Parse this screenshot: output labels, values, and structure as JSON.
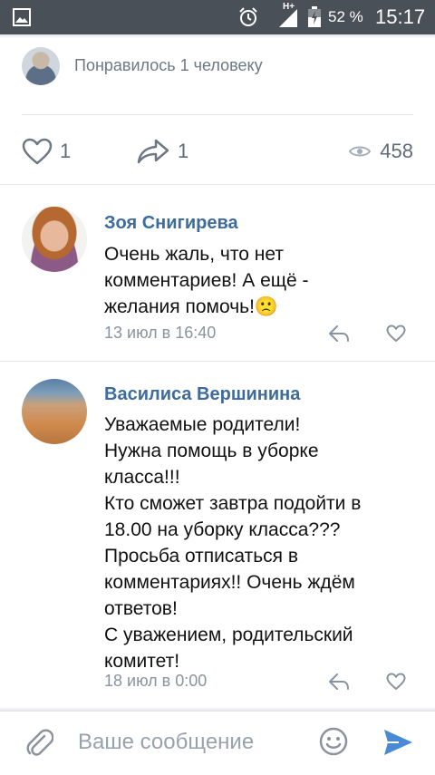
{
  "status_bar": {
    "network": "H+",
    "battery_percent": "52 %",
    "time": "15:17"
  },
  "post": {
    "liked_by": "Понравилось 1 человеку",
    "likes": "1",
    "shares": "1",
    "views": "458"
  },
  "comments": [
    {
      "author": "Зоя Снигирева",
      "text": "Очень жаль, что нет\nкомментариев! А ещё -\nжелания помочь!",
      "emoji": "🙁",
      "date": "13 июл в 16:40"
    },
    {
      "author": "Василиса Вершинина",
      "text": "Уважаемые родители!\nНужна помощь в уборке\nкласса!!!\nКто сможет завтра подойти в\n18.00 на уборку класса???\n Просьба отписаться в\nкомментариях!! Очень ждём\nответов!\nС уважением, родительский\nкомитет!",
      "date": "18 июл в 0:00"
    }
  ],
  "composer": {
    "placeholder": "Ваше сообщение"
  },
  "colors": {
    "status_bar": "#4a5057",
    "author_name": "#3d6b9c",
    "muted": "#8a939e",
    "send": "#4a8ad4"
  },
  "icons": [
    "gallery-icon",
    "alarm-icon",
    "signal-icon",
    "battery-icon",
    "heart-icon",
    "share-icon",
    "eye-icon",
    "reply-icon",
    "attach-icon",
    "emoji-icon",
    "send-icon"
  ]
}
